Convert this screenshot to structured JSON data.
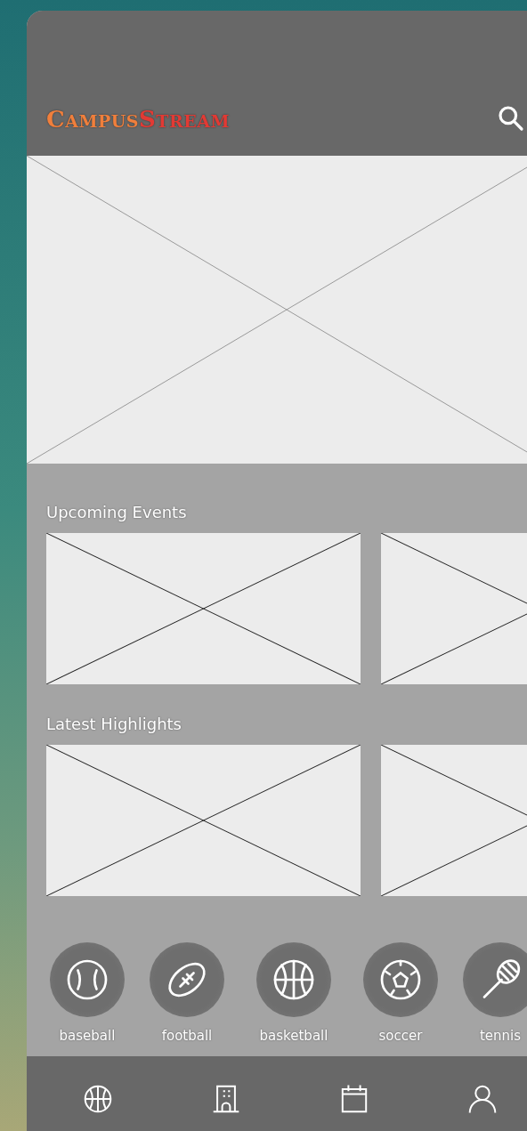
{
  "header": {
    "logo": [
      {
        "text": "CAMPUS",
        "color": "#f07f3c"
      },
      {
        "text": "STREAM",
        "color": "#e23a34"
      }
    ]
  },
  "hero": {
    "kind": "placeholder"
  },
  "sections": [
    {
      "title": "Upcoming Events",
      "cards": [
        {
          "kind": "placeholder"
        },
        {
          "kind": "placeholder"
        }
      ]
    },
    {
      "title": "Latest Highlights",
      "cards": [
        {
          "kind": "placeholder"
        },
        {
          "kind": "placeholder"
        }
      ]
    }
  ],
  "sports": [
    {
      "label": "baseball"
    },
    {
      "label": "football"
    },
    {
      "label": "basketball"
    },
    {
      "label": "soccer"
    },
    {
      "label": "tennis"
    }
  ]
}
